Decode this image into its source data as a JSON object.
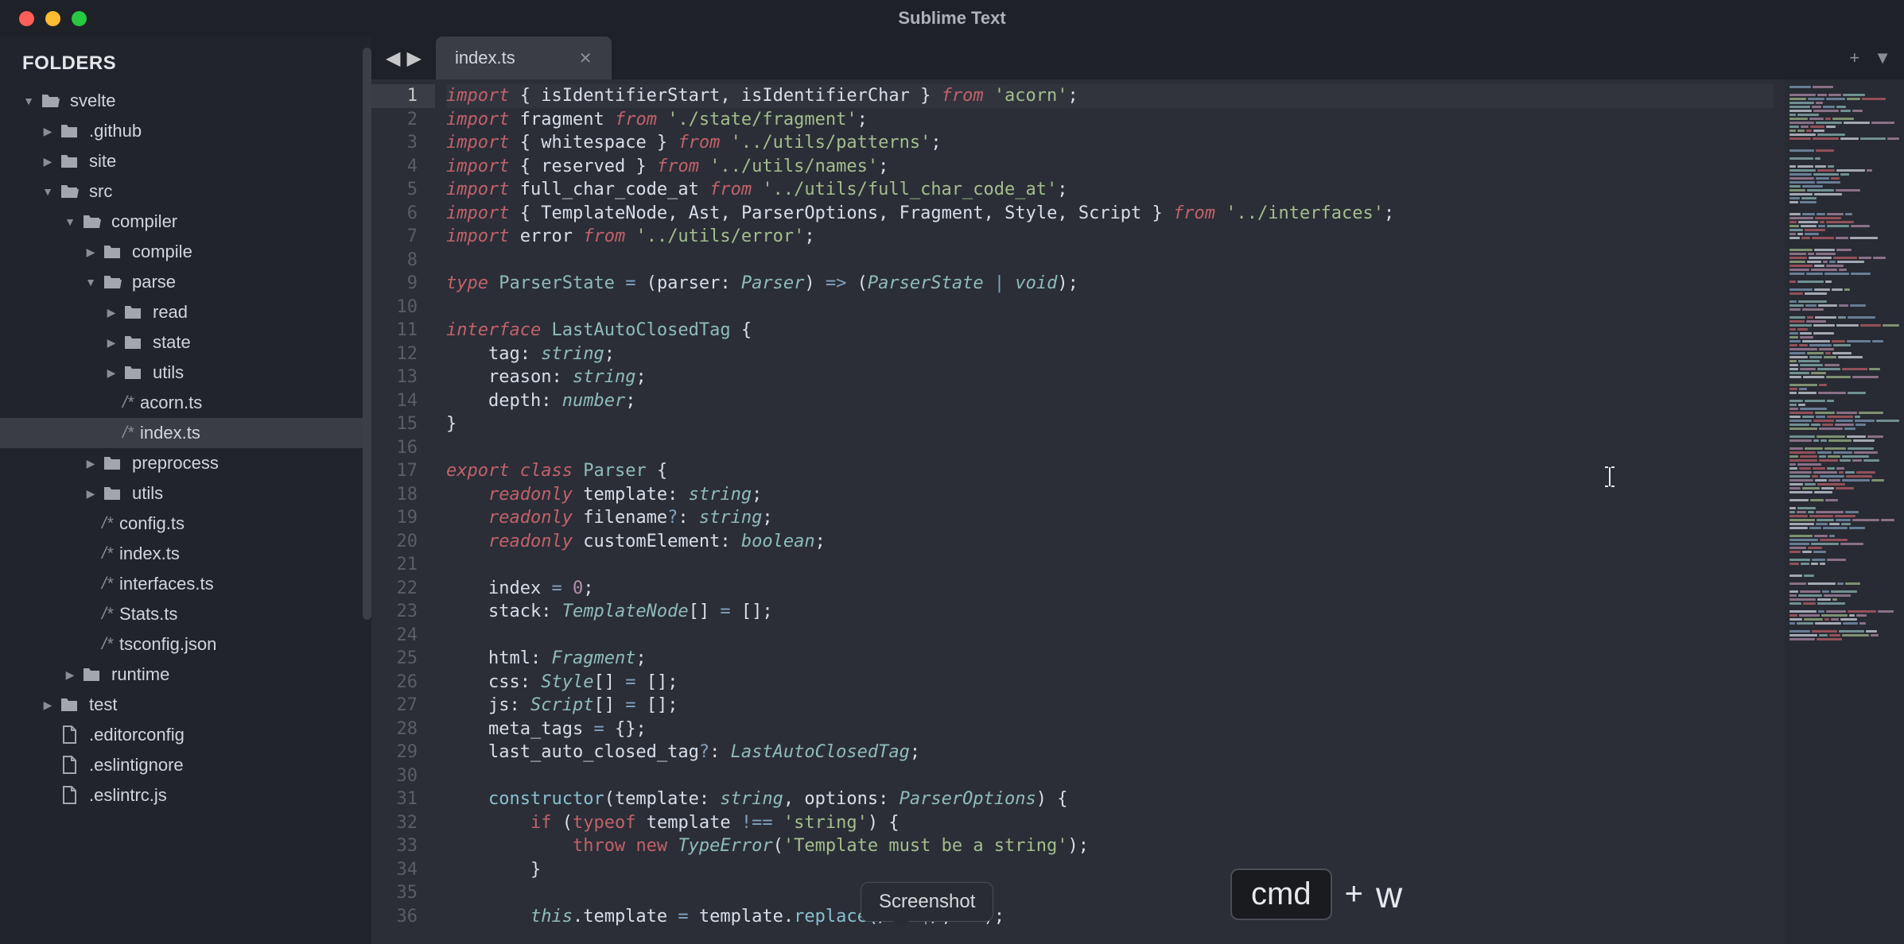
{
  "window": {
    "title": "Sublime Text"
  },
  "sidebar": {
    "header": "FOLDERS",
    "tree": [
      {
        "indent": 0,
        "arrow": "down",
        "icon": "folder-open",
        "label": "svelte"
      },
      {
        "indent": 1,
        "arrow": "right",
        "icon": "folder",
        "label": ".github"
      },
      {
        "indent": 1,
        "arrow": "right",
        "icon": "folder",
        "label": "site"
      },
      {
        "indent": 1,
        "arrow": "down",
        "icon": "folder-open",
        "label": "src"
      },
      {
        "indent": 2,
        "arrow": "down",
        "icon": "folder-open",
        "label": "compiler"
      },
      {
        "indent": 3,
        "arrow": "right",
        "icon": "folder",
        "label": "compile"
      },
      {
        "indent": 3,
        "arrow": "down",
        "icon": "folder-open",
        "label": "parse"
      },
      {
        "indent": 4,
        "arrow": "right",
        "icon": "folder",
        "label": "read"
      },
      {
        "indent": 4,
        "arrow": "right",
        "icon": "folder",
        "label": "state"
      },
      {
        "indent": 4,
        "arrow": "right",
        "icon": "folder",
        "label": "utils"
      },
      {
        "indent": 4,
        "arrow": "",
        "icon": "ts",
        "label": "acorn.ts"
      },
      {
        "indent": 4,
        "arrow": "",
        "icon": "ts",
        "label": "index.ts",
        "selected": true
      },
      {
        "indent": 3,
        "arrow": "right",
        "icon": "folder",
        "label": "preprocess"
      },
      {
        "indent": 3,
        "arrow": "right",
        "icon": "folder",
        "label": "utils"
      },
      {
        "indent": 3,
        "arrow": "",
        "icon": "ts",
        "label": "config.ts"
      },
      {
        "indent": 3,
        "arrow": "",
        "icon": "ts",
        "label": "index.ts"
      },
      {
        "indent": 3,
        "arrow": "",
        "icon": "ts",
        "label": "interfaces.ts"
      },
      {
        "indent": 3,
        "arrow": "",
        "icon": "ts",
        "label": "Stats.ts"
      },
      {
        "indent": 3,
        "arrow": "",
        "icon": "ts",
        "label": "tsconfig.json"
      },
      {
        "indent": 2,
        "arrow": "right",
        "icon": "folder",
        "label": "runtime"
      },
      {
        "indent": 1,
        "arrow": "right",
        "icon": "folder",
        "label": "test"
      },
      {
        "indent": 1,
        "arrow": "",
        "icon": "file",
        "label": ".editorconfig"
      },
      {
        "indent": 1,
        "arrow": "",
        "icon": "file",
        "label": ".eslintignore"
      },
      {
        "indent": 1,
        "arrow": "",
        "icon": "file",
        "label": ".eslintrc.js"
      }
    ]
  },
  "tabs": {
    "active": {
      "label": "index.ts"
    }
  },
  "code": {
    "lines": [
      {
        "n": 1,
        "current": true,
        "tokens": [
          [
            "kw",
            "import"
          ],
          [
            "punct",
            " { "
          ],
          [
            "var",
            "isIdentifierStart"
          ],
          [
            "punct",
            ", "
          ],
          [
            "var",
            "isIdentifierChar"
          ],
          [
            "punct",
            " } "
          ],
          [
            "kw",
            "from"
          ],
          [
            "punct",
            " "
          ],
          [
            "str",
            "'acorn'"
          ],
          [
            "punct",
            ";"
          ]
        ]
      },
      {
        "n": 2,
        "tokens": [
          [
            "kw",
            "import"
          ],
          [
            "punct",
            " "
          ],
          [
            "var",
            "fragment"
          ],
          [
            "punct",
            " "
          ],
          [
            "kw",
            "from"
          ],
          [
            "punct",
            " "
          ],
          [
            "str",
            "'./state/fragment'"
          ],
          [
            "punct",
            ";"
          ]
        ]
      },
      {
        "n": 3,
        "tokens": [
          [
            "kw",
            "import"
          ],
          [
            "punct",
            " { "
          ],
          [
            "var",
            "whitespace"
          ],
          [
            "punct",
            " } "
          ],
          [
            "kw",
            "from"
          ],
          [
            "punct",
            " "
          ],
          [
            "str",
            "'../utils/patterns'"
          ],
          [
            "punct",
            ";"
          ]
        ]
      },
      {
        "n": 4,
        "tokens": [
          [
            "kw",
            "import"
          ],
          [
            "punct",
            " { "
          ],
          [
            "var",
            "reserved"
          ],
          [
            "punct",
            " } "
          ],
          [
            "kw",
            "from"
          ],
          [
            "punct",
            " "
          ],
          [
            "str",
            "'../utils/names'"
          ],
          [
            "punct",
            ";"
          ]
        ]
      },
      {
        "n": 5,
        "tokens": [
          [
            "kw",
            "import"
          ],
          [
            "punct",
            " "
          ],
          [
            "var",
            "full_char_code_at"
          ],
          [
            "punct",
            " "
          ],
          [
            "kw",
            "from"
          ],
          [
            "punct",
            " "
          ],
          [
            "str",
            "'../utils/full_char_code_at'"
          ],
          [
            "punct",
            ";"
          ]
        ]
      },
      {
        "n": 6,
        "tokens": [
          [
            "kw",
            "import"
          ],
          [
            "punct",
            " { "
          ],
          [
            "var",
            "TemplateNode"
          ],
          [
            "punct",
            ", "
          ],
          [
            "var",
            "Ast"
          ],
          [
            "punct",
            ", "
          ],
          [
            "var",
            "ParserOptions"
          ],
          [
            "punct",
            ", "
          ],
          [
            "var",
            "Fragment"
          ],
          [
            "punct",
            ", "
          ],
          [
            "var",
            "Style"
          ],
          [
            "punct",
            ", "
          ],
          [
            "var",
            "Script"
          ],
          [
            "punct",
            " } "
          ],
          [
            "kw",
            "from"
          ],
          [
            "punct",
            " "
          ],
          [
            "str",
            "'../interfaces'"
          ],
          [
            "punct",
            ";"
          ]
        ]
      },
      {
        "n": 7,
        "tokens": [
          [
            "kw",
            "import"
          ],
          [
            "punct",
            " "
          ],
          [
            "var",
            "error"
          ],
          [
            "punct",
            " "
          ],
          [
            "kw",
            "from"
          ],
          [
            "punct",
            " "
          ],
          [
            "str",
            "'../utils/error'"
          ],
          [
            "punct",
            ";"
          ]
        ]
      },
      {
        "n": 8,
        "tokens": []
      },
      {
        "n": 9,
        "tokens": [
          [
            "kw",
            "type"
          ],
          [
            "punct",
            " "
          ],
          [
            "class",
            "ParserState"
          ],
          [
            "punct",
            " "
          ],
          [
            "op",
            "="
          ],
          [
            "punct",
            " ("
          ],
          [
            "var",
            "parser"
          ],
          [
            "punct",
            ": "
          ],
          [
            "type",
            "Parser"
          ],
          [
            "punct",
            ") "
          ],
          [
            "op",
            "=>"
          ],
          [
            "punct",
            " ("
          ],
          [
            "type",
            "ParserState"
          ],
          [
            "punct",
            " "
          ],
          [
            "op",
            "|"
          ],
          [
            "punct",
            " "
          ],
          [
            "type",
            "void"
          ],
          [
            "punct",
            ");"
          ]
        ]
      },
      {
        "n": 10,
        "tokens": []
      },
      {
        "n": 11,
        "tokens": [
          [
            "kw",
            "interface"
          ],
          [
            "punct",
            " "
          ],
          [
            "class",
            "LastAutoClosedTag"
          ],
          [
            "punct",
            " {"
          ]
        ]
      },
      {
        "n": 12,
        "tokens": [
          [
            "punct",
            "    "
          ],
          [
            "var",
            "tag"
          ],
          [
            "punct",
            ": "
          ],
          [
            "type",
            "string"
          ],
          [
            "punct",
            ";"
          ]
        ]
      },
      {
        "n": 13,
        "tokens": [
          [
            "punct",
            "    "
          ],
          [
            "var",
            "reason"
          ],
          [
            "punct",
            ": "
          ],
          [
            "type",
            "string"
          ],
          [
            "punct",
            ";"
          ]
        ]
      },
      {
        "n": 14,
        "tokens": [
          [
            "punct",
            "    "
          ],
          [
            "var",
            "depth"
          ],
          [
            "punct",
            ": "
          ],
          [
            "type",
            "number"
          ],
          [
            "punct",
            ";"
          ]
        ]
      },
      {
        "n": 15,
        "tokens": [
          [
            "punct",
            "}"
          ]
        ]
      },
      {
        "n": 16,
        "tokens": []
      },
      {
        "n": 17,
        "tokens": [
          [
            "kw",
            "export"
          ],
          [
            "punct",
            " "
          ],
          [
            "kw",
            "class"
          ],
          [
            "punct",
            " "
          ],
          [
            "class",
            "Parser"
          ],
          [
            "punct",
            " {"
          ]
        ]
      },
      {
        "n": 18,
        "tokens": [
          [
            "punct",
            "    "
          ],
          [
            "mod",
            "readonly"
          ],
          [
            "punct",
            " "
          ],
          [
            "var",
            "template"
          ],
          [
            "punct",
            ": "
          ],
          [
            "type",
            "string"
          ],
          [
            "punct",
            ";"
          ]
        ]
      },
      {
        "n": 19,
        "tokens": [
          [
            "punct",
            "    "
          ],
          [
            "mod",
            "readonly"
          ],
          [
            "punct",
            " "
          ],
          [
            "var",
            "filename"
          ],
          [
            "op",
            "?"
          ],
          [
            "punct",
            ": "
          ],
          [
            "type",
            "string"
          ],
          [
            "punct",
            ";"
          ]
        ]
      },
      {
        "n": 20,
        "tokens": [
          [
            "punct",
            "    "
          ],
          [
            "mod",
            "readonly"
          ],
          [
            "punct",
            " "
          ],
          [
            "var",
            "customElement"
          ],
          [
            "punct",
            ": "
          ],
          [
            "type",
            "boolean"
          ],
          [
            "punct",
            ";"
          ]
        ]
      },
      {
        "n": 21,
        "tokens": []
      },
      {
        "n": 22,
        "tokens": [
          [
            "punct",
            "    "
          ],
          [
            "var",
            "index"
          ],
          [
            "punct",
            " "
          ],
          [
            "op",
            "="
          ],
          [
            "punct",
            " "
          ],
          [
            "num",
            "0"
          ],
          [
            "punct",
            ";"
          ]
        ]
      },
      {
        "n": 23,
        "tokens": [
          [
            "punct",
            "    "
          ],
          [
            "var",
            "stack"
          ],
          [
            "punct",
            ": "
          ],
          [
            "type",
            "TemplateNode"
          ],
          [
            "punct",
            "[] "
          ],
          [
            "op",
            "="
          ],
          [
            "punct",
            " [];"
          ]
        ]
      },
      {
        "n": 24,
        "tokens": []
      },
      {
        "n": 25,
        "tokens": [
          [
            "punct",
            "    "
          ],
          [
            "var",
            "html"
          ],
          [
            "punct",
            ": "
          ],
          [
            "type",
            "Fragment"
          ],
          [
            "punct",
            ";"
          ]
        ]
      },
      {
        "n": 26,
        "tokens": [
          [
            "punct",
            "    "
          ],
          [
            "var",
            "css"
          ],
          [
            "punct",
            ": "
          ],
          [
            "type",
            "Style"
          ],
          [
            "punct",
            "[] "
          ],
          [
            "op",
            "="
          ],
          [
            "punct",
            " [];"
          ]
        ]
      },
      {
        "n": 27,
        "tokens": [
          [
            "punct",
            "    "
          ],
          [
            "var",
            "js"
          ],
          [
            "punct",
            ": "
          ],
          [
            "type",
            "Script"
          ],
          [
            "punct",
            "[] "
          ],
          [
            "op",
            "="
          ],
          [
            "punct",
            " [];"
          ]
        ]
      },
      {
        "n": 28,
        "tokens": [
          [
            "punct",
            "    "
          ],
          [
            "var",
            "meta_tags"
          ],
          [
            "punct",
            " "
          ],
          [
            "op",
            "="
          ],
          [
            "punct",
            " {};"
          ]
        ]
      },
      {
        "n": 29,
        "tokens": [
          [
            "punct",
            "    "
          ],
          [
            "var",
            "last_auto_closed_tag"
          ],
          [
            "op",
            "?"
          ],
          [
            "punct",
            ": "
          ],
          [
            "type",
            "LastAutoClosedTag"
          ],
          [
            "punct",
            ";"
          ]
        ]
      },
      {
        "n": 30,
        "tokens": []
      },
      {
        "n": 31,
        "tokens": [
          [
            "punct",
            "    "
          ],
          [
            "fn",
            "constructor"
          ],
          [
            "punct",
            "("
          ],
          [
            "var",
            "template"
          ],
          [
            "punct",
            ": "
          ],
          [
            "type",
            "string"
          ],
          [
            "punct",
            ", "
          ],
          [
            "var",
            "options"
          ],
          [
            "punct",
            ": "
          ],
          [
            "type",
            "ParserOptions"
          ],
          [
            "punct",
            ") {"
          ]
        ]
      },
      {
        "n": 32,
        "tokens": [
          [
            "punct",
            "        "
          ],
          [
            "kw2",
            "if"
          ],
          [
            "punct",
            " ("
          ],
          [
            "kw2",
            "typeof"
          ],
          [
            "punct",
            " "
          ],
          [
            "var",
            "template"
          ],
          [
            "punct",
            " "
          ],
          [
            "op",
            "!=="
          ],
          [
            "punct",
            " "
          ],
          [
            "str",
            "'string'"
          ],
          [
            "punct",
            ") {"
          ]
        ]
      },
      {
        "n": 33,
        "tokens": [
          [
            "punct",
            "            "
          ],
          [
            "kw2",
            "throw"
          ],
          [
            "punct",
            " "
          ],
          [
            "kw2",
            "new"
          ],
          [
            "punct",
            " "
          ],
          [
            "type",
            "TypeError"
          ],
          [
            "punct",
            "("
          ],
          [
            "str",
            "'Template must be a string'"
          ],
          [
            "punct",
            ");"
          ]
        ]
      },
      {
        "n": 34,
        "tokens": [
          [
            "punct",
            "        }"
          ]
        ]
      },
      {
        "n": 35,
        "tokens": []
      },
      {
        "n": 36,
        "tokens": [
          [
            "punct",
            "        "
          ],
          [
            "type",
            "this"
          ],
          [
            "punct",
            "."
          ],
          [
            "var",
            "template"
          ],
          [
            "punct",
            " "
          ],
          [
            "op",
            "="
          ],
          [
            "punct",
            " "
          ],
          [
            "var",
            "template"
          ],
          [
            "punct",
            "."
          ],
          [
            "fn",
            "replace"
          ],
          [
            "punct",
            "(/\\s+$/, "
          ],
          [
            "str",
            "''"
          ],
          [
            "punct",
            ");"
          ]
        ]
      }
    ]
  },
  "tooltip": {
    "label": "Screenshot"
  },
  "keys": {
    "modifier": "cmd",
    "plus": "+",
    "letter": "w"
  },
  "minimap_colors": [
    "#c2616a",
    "#a3be8c",
    "#8fbcbb",
    "#d8dee9",
    "#81a1c1",
    "#b48ead"
  ]
}
